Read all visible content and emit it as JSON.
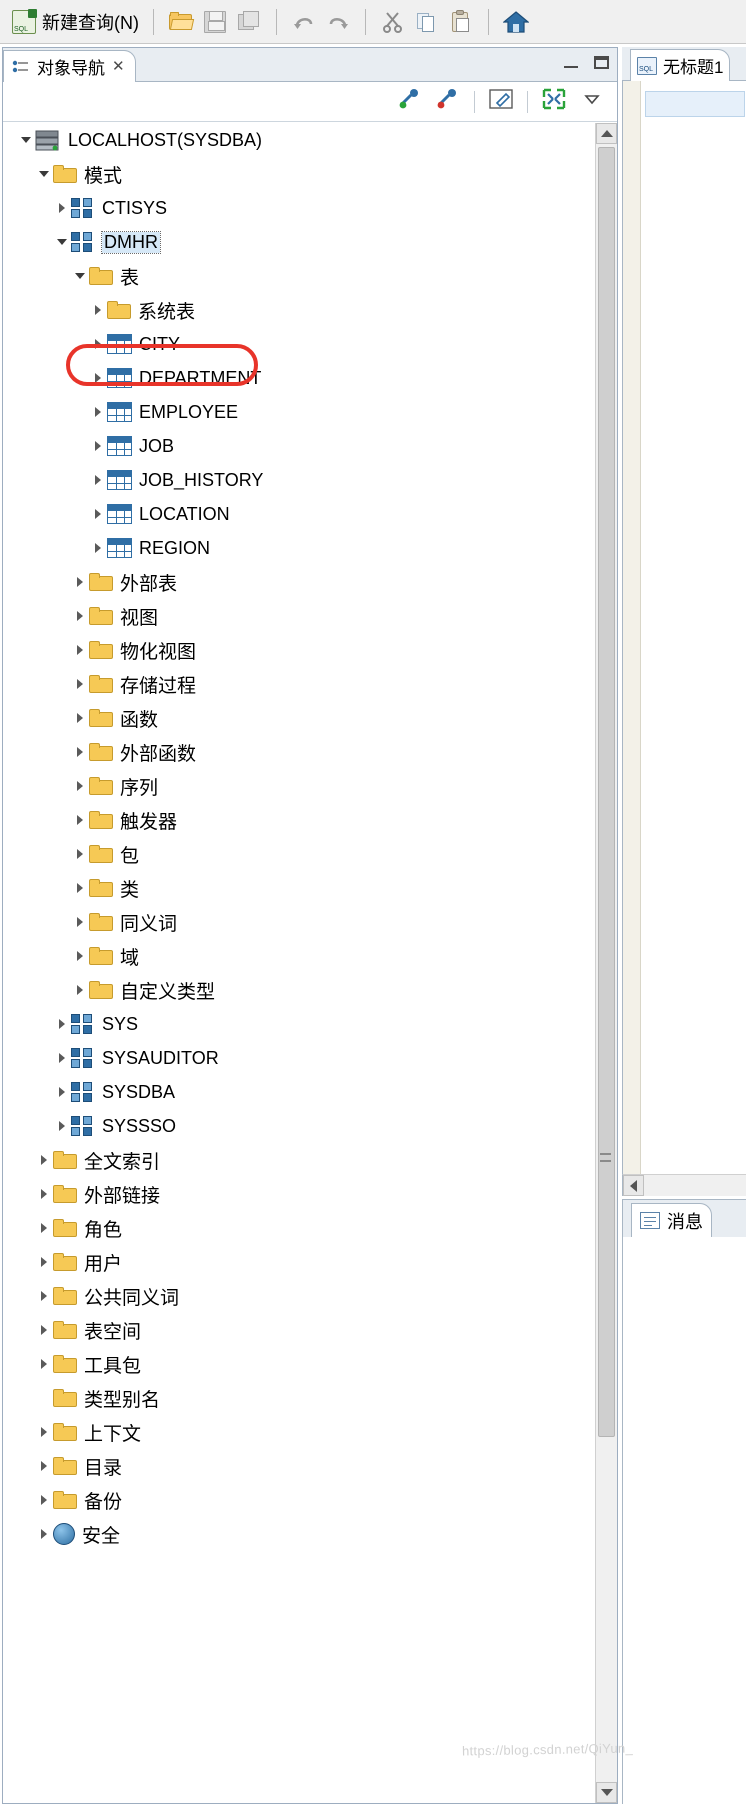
{
  "toolbar": {
    "new_query_label": "新建查询(N)",
    "icons": [
      {
        "name": "sql-new-icon"
      },
      {
        "name": "open-folder-icon"
      },
      {
        "name": "save-icon"
      },
      {
        "name": "save-all-icon"
      },
      {
        "name": "undo-icon"
      },
      {
        "name": "redo-icon"
      },
      {
        "name": "cut-icon"
      },
      {
        "name": "copy-icon"
      },
      {
        "name": "paste-icon"
      },
      {
        "name": "home-icon"
      }
    ]
  },
  "nav_panel": {
    "tab_title": "对象导航",
    "close_glyph": "✕",
    "toolbar_icons": [
      {
        "name": "refresh-connect-icon"
      },
      {
        "name": "disconnect-icon"
      },
      {
        "name": "edit-icon"
      },
      {
        "name": "collapse-all-icon"
      },
      {
        "name": "view-menu-icon"
      }
    ],
    "highlight_color": "#e8342a"
  },
  "tree": {
    "nodes": [
      {
        "label": "LOCALHOST(SYSDBA)",
        "icon": "database-server-icon",
        "indent": 0,
        "state": "open",
        "selected": false,
        "cjk": false
      },
      {
        "label": "模式",
        "icon": "folder-icon",
        "indent": 1,
        "state": "open",
        "selected": false,
        "cjk": true
      },
      {
        "label": "CTISYS",
        "icon": "schema-icon",
        "indent": 2,
        "state": "closed",
        "selected": false,
        "cjk": false
      },
      {
        "label": "DMHR",
        "icon": "schema-icon",
        "indent": 2,
        "state": "open",
        "selected": true,
        "cjk": false
      },
      {
        "label": "表",
        "icon": "folder-icon",
        "indent": 3,
        "state": "open",
        "selected": false,
        "cjk": true
      },
      {
        "label": "系统表",
        "icon": "folder-icon",
        "indent": 4,
        "state": "closed",
        "selected": false,
        "cjk": true
      },
      {
        "label": "CITY",
        "icon": "table-icon",
        "indent": 4,
        "state": "closed",
        "selected": false,
        "cjk": false
      },
      {
        "label": "DEPARTMENT",
        "icon": "table-icon",
        "indent": 4,
        "state": "closed",
        "selected": false,
        "cjk": false
      },
      {
        "label": "EMPLOYEE",
        "icon": "table-icon",
        "indent": 4,
        "state": "closed",
        "selected": false,
        "cjk": false
      },
      {
        "label": "JOB",
        "icon": "table-icon",
        "indent": 4,
        "state": "closed",
        "selected": false,
        "cjk": false
      },
      {
        "label": "JOB_HISTORY",
        "icon": "table-icon",
        "indent": 4,
        "state": "closed",
        "selected": false,
        "cjk": false
      },
      {
        "label": "LOCATION",
        "icon": "table-icon",
        "indent": 4,
        "state": "closed",
        "selected": false,
        "cjk": false
      },
      {
        "label": "REGION",
        "icon": "table-icon",
        "indent": 4,
        "state": "closed",
        "selected": false,
        "cjk": false
      },
      {
        "label": "外部表",
        "icon": "folder-icon",
        "indent": 3,
        "state": "closed",
        "selected": false,
        "cjk": true
      },
      {
        "label": "视图",
        "icon": "folder-icon",
        "indent": 3,
        "state": "closed",
        "selected": false,
        "cjk": true
      },
      {
        "label": "物化视图",
        "icon": "folder-icon",
        "indent": 3,
        "state": "closed",
        "selected": false,
        "cjk": true
      },
      {
        "label": "存储过程",
        "icon": "folder-icon",
        "indent": 3,
        "state": "closed",
        "selected": false,
        "cjk": true
      },
      {
        "label": "函数",
        "icon": "folder-icon",
        "indent": 3,
        "state": "closed",
        "selected": false,
        "cjk": true
      },
      {
        "label": "外部函数",
        "icon": "folder-icon",
        "indent": 3,
        "state": "closed",
        "selected": false,
        "cjk": true
      },
      {
        "label": "序列",
        "icon": "folder-icon",
        "indent": 3,
        "state": "closed",
        "selected": false,
        "cjk": true
      },
      {
        "label": "触发器",
        "icon": "folder-icon",
        "indent": 3,
        "state": "closed",
        "selected": false,
        "cjk": true
      },
      {
        "label": "包",
        "icon": "folder-icon",
        "indent": 3,
        "state": "closed",
        "selected": false,
        "cjk": true
      },
      {
        "label": "类",
        "icon": "folder-icon",
        "indent": 3,
        "state": "closed",
        "selected": false,
        "cjk": true
      },
      {
        "label": "同义词",
        "icon": "folder-icon",
        "indent": 3,
        "state": "closed",
        "selected": false,
        "cjk": true
      },
      {
        "label": "域",
        "icon": "folder-icon",
        "indent": 3,
        "state": "closed",
        "selected": false,
        "cjk": true
      },
      {
        "label": "自定义类型",
        "icon": "folder-icon",
        "indent": 3,
        "state": "closed",
        "selected": false,
        "cjk": true
      },
      {
        "label": "SYS",
        "icon": "schema-icon",
        "indent": 2,
        "state": "closed",
        "selected": false,
        "cjk": false
      },
      {
        "label": "SYSAUDITOR",
        "icon": "schema-icon",
        "indent": 2,
        "state": "closed",
        "selected": false,
        "cjk": false
      },
      {
        "label": "SYSDBA",
        "icon": "schema-icon",
        "indent": 2,
        "state": "closed",
        "selected": false,
        "cjk": false
      },
      {
        "label": "SYSSSO",
        "icon": "schema-icon",
        "indent": 2,
        "state": "closed",
        "selected": false,
        "cjk": false
      },
      {
        "label": "全文索引",
        "icon": "folder-icon",
        "indent": 1,
        "state": "closed",
        "selected": false,
        "cjk": true
      },
      {
        "label": "外部链接",
        "icon": "folder-icon",
        "indent": 1,
        "state": "closed",
        "selected": false,
        "cjk": true
      },
      {
        "label": "角色",
        "icon": "folder-icon",
        "indent": 1,
        "state": "closed",
        "selected": false,
        "cjk": true
      },
      {
        "label": "用户",
        "icon": "folder-icon",
        "indent": 1,
        "state": "closed",
        "selected": false,
        "cjk": true
      },
      {
        "label": "公共同义词",
        "icon": "folder-icon",
        "indent": 1,
        "state": "closed",
        "selected": false,
        "cjk": true
      },
      {
        "label": "表空间",
        "icon": "folder-icon",
        "indent": 1,
        "state": "closed",
        "selected": false,
        "cjk": true
      },
      {
        "label": "工具包",
        "icon": "folder-icon",
        "indent": 1,
        "state": "closed",
        "selected": false,
        "cjk": true
      },
      {
        "label": "类型别名",
        "icon": "folder-icon",
        "indent": 1,
        "state": "none",
        "selected": false,
        "cjk": true
      },
      {
        "label": "上下文",
        "icon": "folder-icon",
        "indent": 1,
        "state": "closed",
        "selected": false,
        "cjk": true
      },
      {
        "label": "目录",
        "icon": "folder-icon",
        "indent": 1,
        "state": "closed",
        "selected": false,
        "cjk": true
      },
      {
        "label": "备份",
        "icon": "folder-icon",
        "indent": 1,
        "state": "closed",
        "selected": false,
        "cjk": true
      },
      {
        "label": "安全",
        "icon": "security-icon",
        "indent": 1,
        "state": "closed",
        "selected": false,
        "cjk": true
      }
    ]
  },
  "editor": {
    "tab_title": "无标题1",
    "tab_icon": "sql-file-icon"
  },
  "messages": {
    "tab_title": "消息",
    "tab_icon": "message-icon"
  },
  "watermark": "https://blog.csdn.net/QiYun_"
}
